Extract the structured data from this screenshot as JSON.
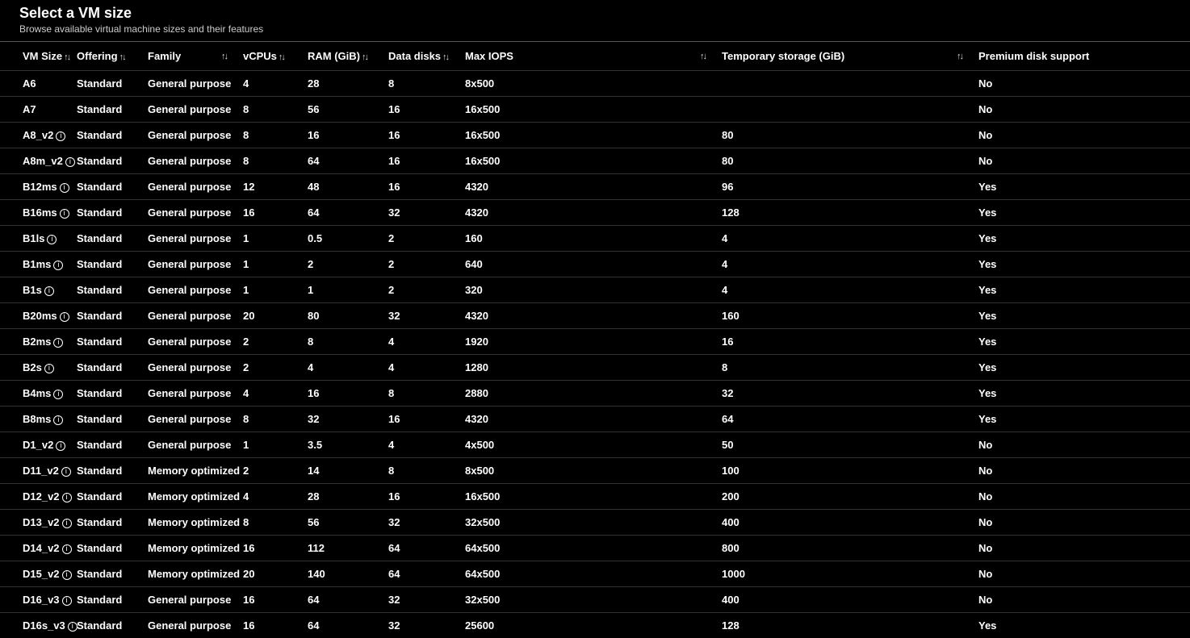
{
  "header": {
    "title": "Select a VM size",
    "subtitle": "Browse available virtual machine sizes and their features"
  },
  "columns": [
    {
      "key": "size",
      "label": "VM Size",
      "sortPos": "inline"
    },
    {
      "key": "offer",
      "label": "Offering",
      "sortPos": "inline"
    },
    {
      "key": "family",
      "label": "Family",
      "sortPos": "right"
    },
    {
      "key": "vcpu",
      "label": "vCPUs",
      "sortPos": "inline"
    },
    {
      "key": "ram",
      "label": "RAM (GiB)",
      "sortPos": "inline"
    },
    {
      "key": "disks",
      "label": "Data disks",
      "sortPos": "inline"
    },
    {
      "key": "iops",
      "label": "Max IOPS",
      "sortPos": "right"
    },
    {
      "key": "temp",
      "label": "Temporary storage (GiB)",
      "sortPos": "right"
    },
    {
      "key": "prem",
      "label": "Premium disk support",
      "sortPos": "none"
    }
  ],
  "rows": [
    {
      "size": "A6",
      "info": false,
      "offer": "Standard",
      "family": "General purpose",
      "vcpu": "4",
      "ram": "28",
      "disks": "8",
      "iops": "8x500",
      "temp": "",
      "prem": "No"
    },
    {
      "size": "A7",
      "info": false,
      "offer": "Standard",
      "family": "General purpose",
      "vcpu": "8",
      "ram": "56",
      "disks": "16",
      "iops": "16x500",
      "temp": "",
      "prem": "No"
    },
    {
      "size": "A8_v2",
      "info": true,
      "offer": "Standard",
      "family": "General purpose",
      "vcpu": "8",
      "ram": "16",
      "disks": "16",
      "iops": "16x500",
      "temp": "80",
      "prem": "No"
    },
    {
      "size": "A8m_v2",
      "info": true,
      "offer": "Standard",
      "family": "General purpose",
      "vcpu": "8",
      "ram": "64",
      "disks": "16",
      "iops": "16x500",
      "temp": "80",
      "prem": "No"
    },
    {
      "size": "B12ms",
      "info": true,
      "offer": "Standard",
      "family": "General purpose",
      "vcpu": "12",
      "ram": "48",
      "disks": "16",
      "iops": "4320",
      "temp": "96",
      "prem": "Yes"
    },
    {
      "size": "B16ms",
      "info": true,
      "offer": "Standard",
      "family": "General purpose",
      "vcpu": "16",
      "ram": "64",
      "disks": "32",
      "iops": "4320",
      "temp": "128",
      "prem": "Yes"
    },
    {
      "size": "B1ls",
      "info": true,
      "offer": "Standard",
      "family": "General purpose",
      "vcpu": "1",
      "ram": "0.5",
      "disks": "2",
      "iops": "160",
      "temp": "4",
      "prem": "Yes"
    },
    {
      "size": "B1ms",
      "info": true,
      "offer": "Standard",
      "family": "General purpose",
      "vcpu": "1",
      "ram": "2",
      "disks": "2",
      "iops": "640",
      "temp": "4",
      "prem": "Yes"
    },
    {
      "size": "B1s",
      "info": true,
      "offer": "Standard",
      "family": "General purpose",
      "vcpu": "1",
      "ram": "1",
      "disks": "2",
      "iops": "320",
      "temp": "4",
      "prem": "Yes"
    },
    {
      "size": "B20ms",
      "info": true,
      "offer": "Standard",
      "family": "General purpose",
      "vcpu": "20",
      "ram": "80",
      "disks": "32",
      "iops": "4320",
      "temp": "160",
      "prem": "Yes"
    },
    {
      "size": "B2ms",
      "info": true,
      "offer": "Standard",
      "family": "General purpose",
      "vcpu": "2",
      "ram": "8",
      "disks": "4",
      "iops": "1920",
      "temp": "16",
      "prem": "Yes"
    },
    {
      "size": "B2s",
      "info": true,
      "offer": "Standard",
      "family": "General purpose",
      "vcpu": "2",
      "ram": "4",
      "disks": "4",
      "iops": "1280",
      "temp": "8",
      "prem": "Yes"
    },
    {
      "size": "B4ms",
      "info": true,
      "offer": "Standard",
      "family": "General purpose",
      "vcpu": "4",
      "ram": "16",
      "disks": "8",
      "iops": "2880",
      "temp": "32",
      "prem": "Yes"
    },
    {
      "size": "B8ms",
      "info": true,
      "offer": "Standard",
      "family": "General purpose",
      "vcpu": "8",
      "ram": "32",
      "disks": "16",
      "iops": "4320",
      "temp": "64",
      "prem": "Yes"
    },
    {
      "size": "D1_v2",
      "info": true,
      "offer": "Standard",
      "family": "General purpose",
      "vcpu": "1",
      "ram": "3.5",
      "disks": "4",
      "iops": "4x500",
      "temp": "50",
      "prem": "No"
    },
    {
      "size": "D11_v2",
      "info": true,
      "offer": "Standard",
      "family": "Memory optimized",
      "vcpu": "2",
      "ram": "14",
      "disks": "8",
      "iops": "8x500",
      "temp": "100",
      "prem": "No"
    },
    {
      "size": "D12_v2",
      "info": true,
      "offer": "Standard",
      "family": "Memory optimized",
      "vcpu": "4",
      "ram": "28",
      "disks": "16",
      "iops": "16x500",
      "temp": "200",
      "prem": "No"
    },
    {
      "size": "D13_v2",
      "info": true,
      "offer": "Standard",
      "family": "Memory optimized",
      "vcpu": "8",
      "ram": "56",
      "disks": "32",
      "iops": "32x500",
      "temp": "400",
      "prem": "No"
    },
    {
      "size": "D14_v2",
      "info": true,
      "offer": "Standard",
      "family": "Memory optimized",
      "vcpu": "16",
      "ram": "112",
      "disks": "64",
      "iops": "64x500",
      "temp": "800",
      "prem": "No"
    },
    {
      "size": "D15_v2",
      "info": true,
      "offer": "Standard",
      "family": "Memory optimized",
      "vcpu": "20",
      "ram": "140",
      "disks": "64",
      "iops": "64x500",
      "temp": "1000",
      "prem": "No"
    },
    {
      "size": "D16_v3",
      "info": true,
      "offer": "Standard",
      "family": "General purpose",
      "vcpu": "16",
      "ram": "64",
      "disks": "32",
      "iops": "32x500",
      "temp": "400",
      "prem": "No"
    },
    {
      "size": "D16s_v3",
      "info": true,
      "offer": "Standard",
      "family": "General purpose",
      "vcpu": "16",
      "ram": "64",
      "disks": "32",
      "iops": "25600",
      "temp": "128",
      "prem": "Yes"
    }
  ]
}
